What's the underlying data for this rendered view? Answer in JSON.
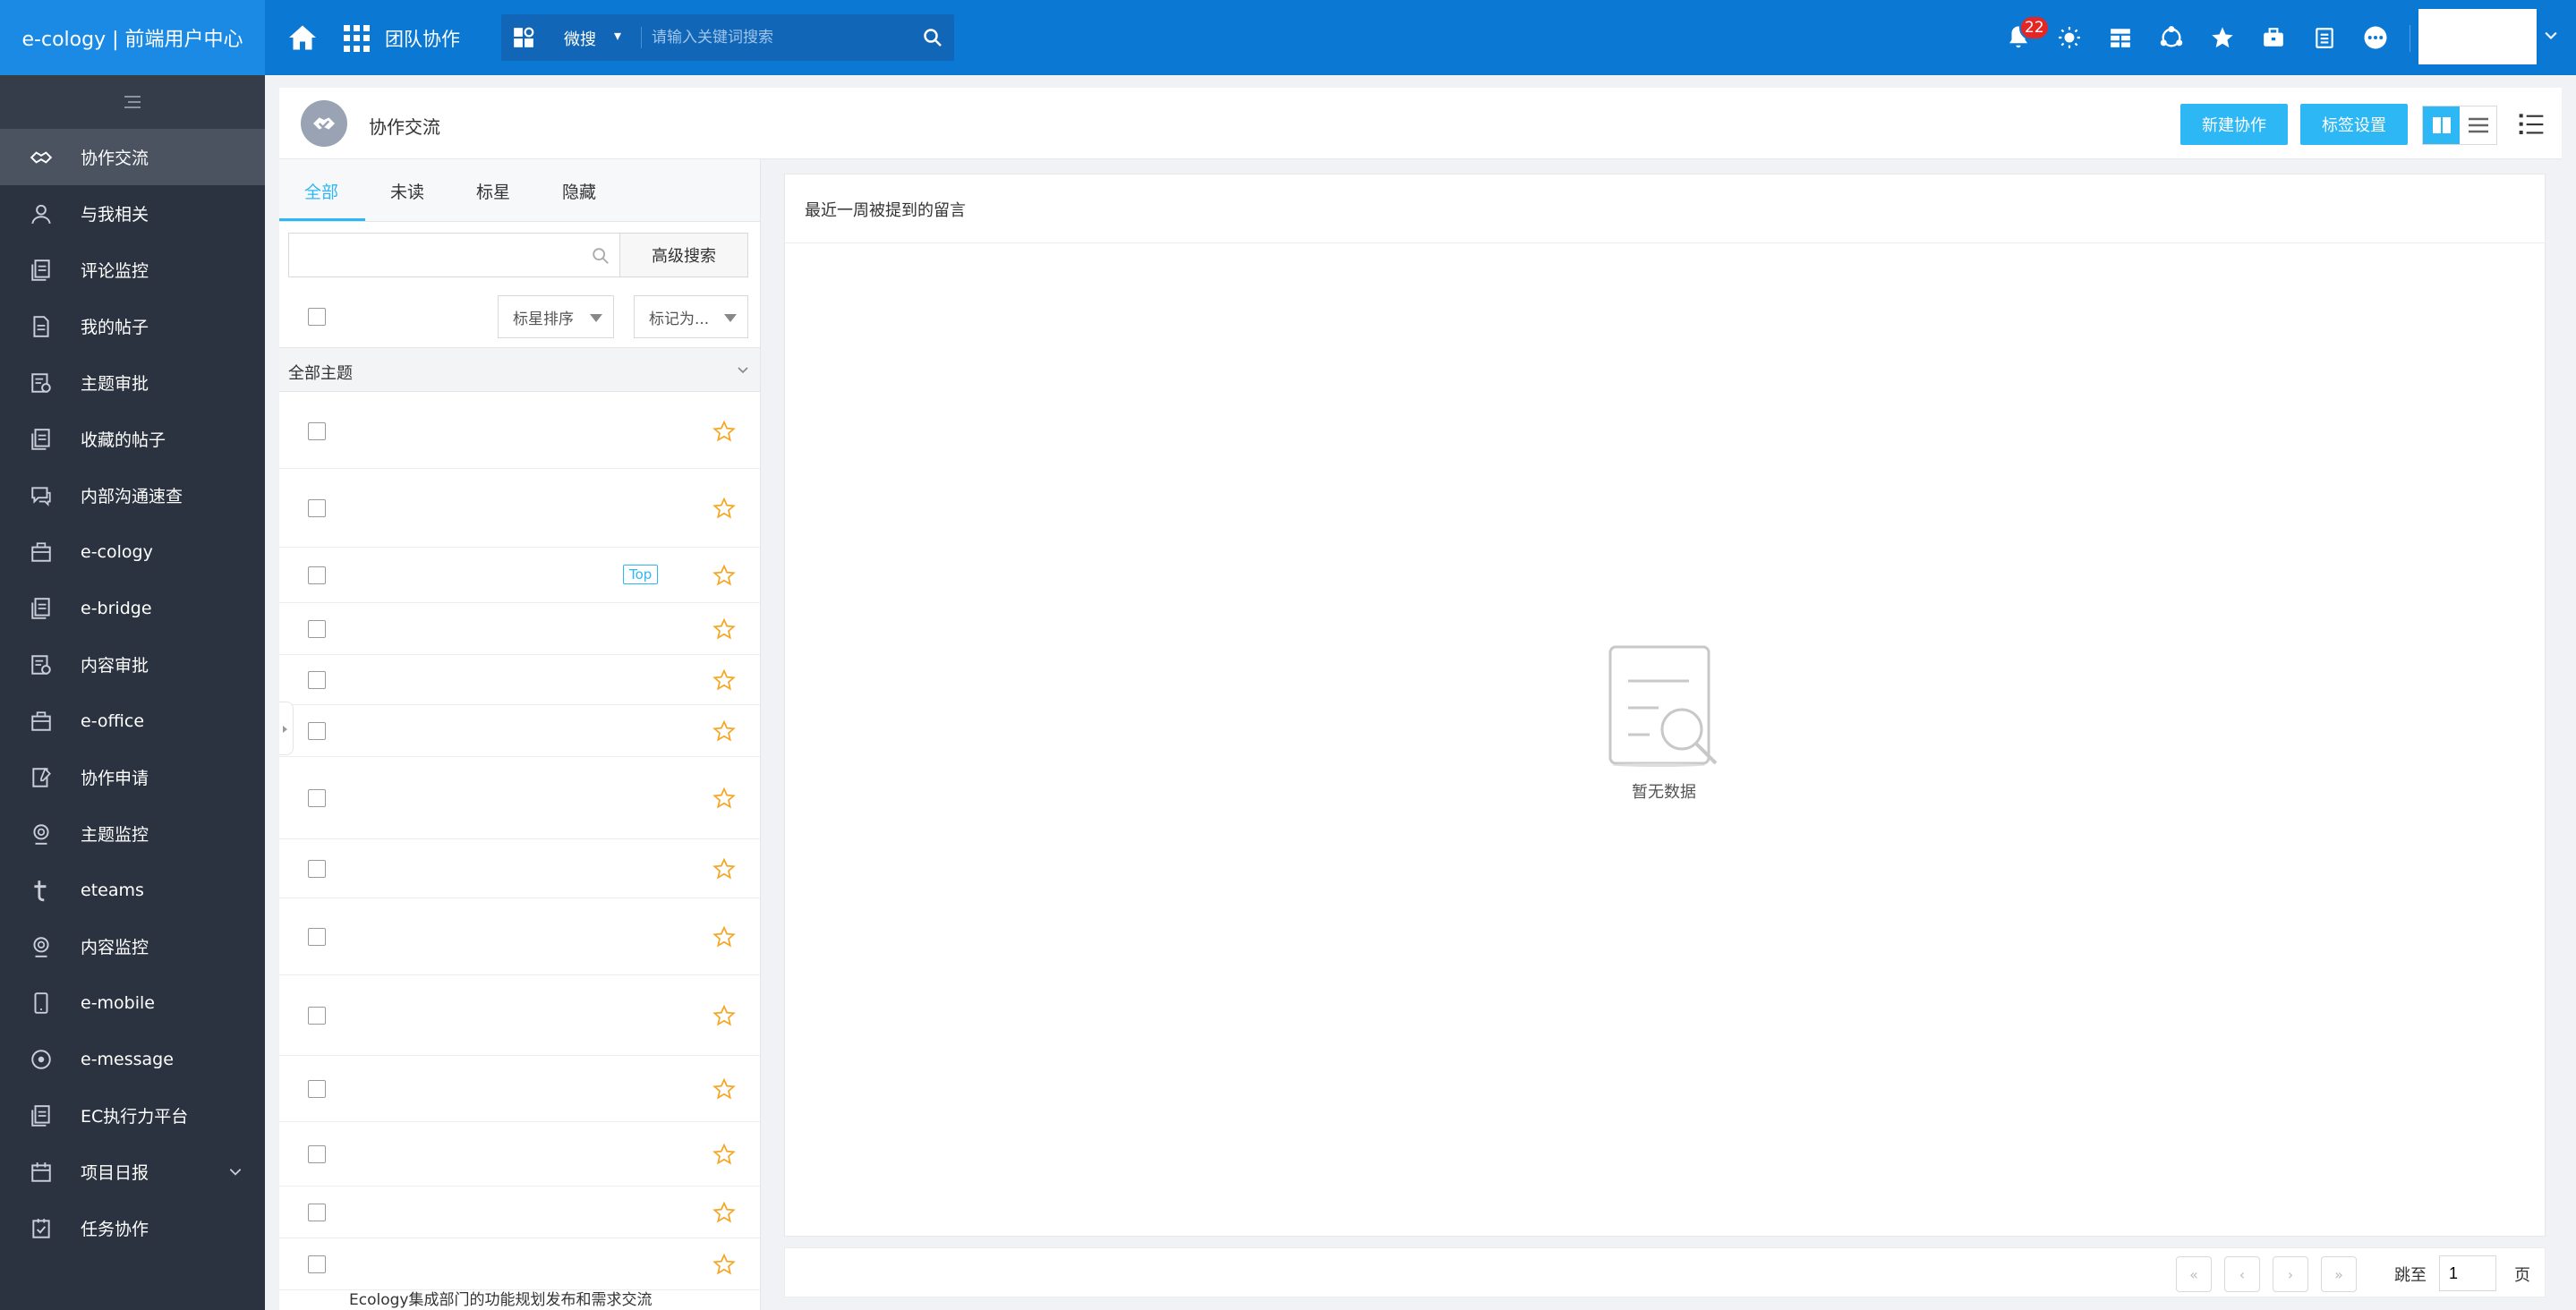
{
  "brand": "e-cology | 前端用户中心",
  "topbar": {
    "team_label": "团队协作",
    "search_scope": "微搜",
    "search_placeholder": "请输入关键词搜索",
    "notification_count": "22",
    "icons": [
      "bell-icon",
      "bulb-icon",
      "grid-icon",
      "circle-nodes-icon",
      "star-icon",
      "briefcase-icon",
      "clipboard-icon",
      "more-icon"
    ]
  },
  "sidebar": {
    "items": [
      {
        "label": "协作交流",
        "icon": "handshake-icon",
        "active": true
      },
      {
        "label": "与我相关",
        "icon": "person-icon"
      },
      {
        "label": "评论监控",
        "icon": "doc-stack-icon"
      },
      {
        "label": "我的帖子",
        "icon": "document-icon"
      },
      {
        "label": "主题审批",
        "icon": "approve-icon"
      },
      {
        "label": "收藏的帖子",
        "icon": "doc-stack-icon"
      },
      {
        "label": "内部沟通速查",
        "icon": "chat-icon"
      },
      {
        "label": "e-cology",
        "icon": "box-icon"
      },
      {
        "label": "e-bridge",
        "icon": "doc-stack-icon"
      },
      {
        "label": "内容审批",
        "icon": "approve-icon"
      },
      {
        "label": "e-office",
        "icon": "box-icon"
      },
      {
        "label": "协作申请",
        "icon": "edit-doc-icon"
      },
      {
        "label": "主题监控",
        "icon": "monitor-icon"
      },
      {
        "label": "eteams",
        "icon": "t-letter-icon"
      },
      {
        "label": "内容监控",
        "icon": "monitor-icon"
      },
      {
        "label": "e-mobile",
        "icon": "phone-icon"
      },
      {
        "label": "e-message",
        "icon": "eye-icon"
      },
      {
        "label": "EC执行力平台",
        "icon": "doc-stack-icon"
      },
      {
        "label": "项目日报",
        "icon": "calendar-icon",
        "expandable": true
      },
      {
        "label": "任务协作",
        "icon": "check-doc-icon"
      }
    ]
  },
  "header": {
    "title": "协作交流",
    "new_button": "新建协作",
    "tags_button": "标签设置"
  },
  "list": {
    "tabs": [
      "全部",
      "未读",
      "标星",
      "隐藏"
    ],
    "advanced_search": "高级搜索",
    "sort_select": "标星排序",
    "mark_select": "标记为...",
    "group_label": "全部主题",
    "top_tag": "Top",
    "footer_text": "Ecology集成部门的功能规划发布和需求交流"
  },
  "right": {
    "title": "最近一周被提到的留言",
    "empty_text": "暂无数据"
  },
  "pager": {
    "jump_label": "跳至",
    "page_value": "1",
    "page_suffix": "页"
  },
  "colors": {
    "topbar": "#0b79d4",
    "brand_bg": "#1a8ae5",
    "sidebar": "#2c3340",
    "accent": "#2db7f5",
    "star": "#f5a623"
  }
}
